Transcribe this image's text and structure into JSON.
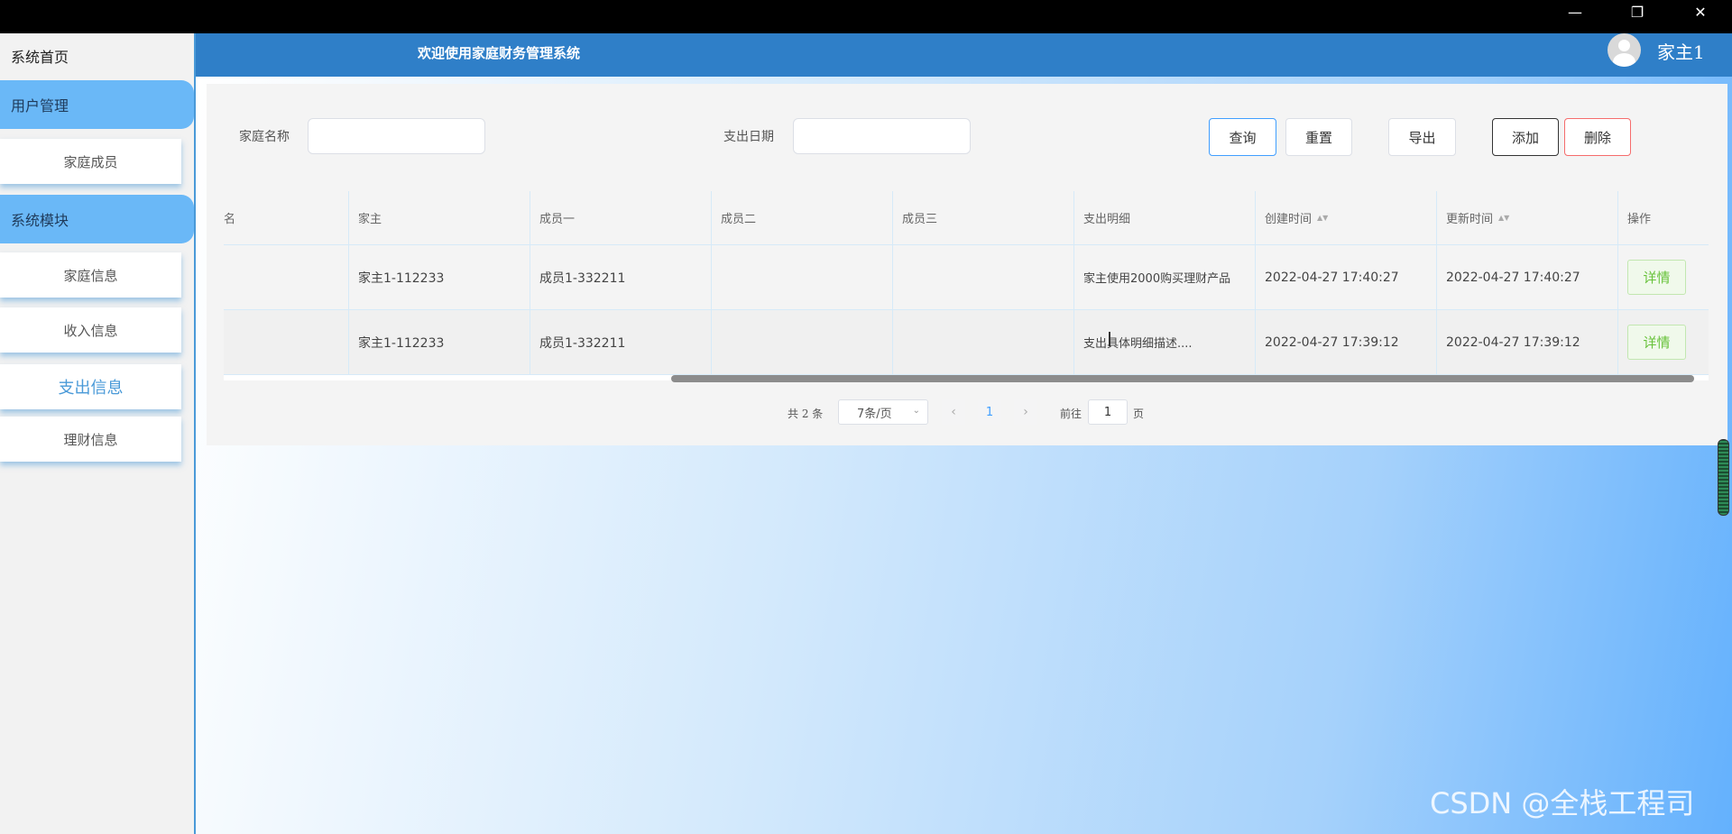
{
  "window": {
    "minimize_glyph": "—",
    "maximize_glyph": "❐",
    "close_glyph": "✕"
  },
  "sidebar": {
    "home": "系统首页",
    "groups": [
      {
        "label": "用户管理",
        "items": [
          {
            "label": "家庭成员",
            "active": false
          }
        ]
      },
      {
        "label": "系统模块",
        "items": [
          {
            "label": "家庭信息",
            "active": false
          },
          {
            "label": "收入信息",
            "active": false
          },
          {
            "label": "支出信息",
            "active": true
          },
          {
            "label": "理财信息",
            "active": false
          }
        ]
      }
    ]
  },
  "header": {
    "welcome": "欢迎使用家庭财务管理系统",
    "username": "家主1"
  },
  "filters": {
    "family_name_label": "家庭名称",
    "family_name_value": "",
    "expense_date_label": "支出日期",
    "expense_date_value": ""
  },
  "toolbar": {
    "query": "查询",
    "reset": "重置",
    "export": "导出",
    "add": "添加",
    "delete": "删除"
  },
  "table": {
    "columns": [
      "名",
      "家主",
      "成员一",
      "成员二",
      "成员三",
      "支出明细",
      "创建时间",
      "更新时间",
      "操作"
    ],
    "sort_glyph": "▲▼",
    "rows": [
      {
        "c0": "",
        "head": "家主1-112233",
        "member1": "成员1-332211",
        "member2": "",
        "member3": "",
        "detail": "家主使用2000购买理财产品",
        "created": "2022-04-27 17:40:27",
        "updated": "2022-04-27 17:40:27",
        "action": "详情"
      },
      {
        "c0": "",
        "head": "家主1-112233",
        "member1": "成员1-332211",
        "member2": "",
        "member3": "",
        "detail": "支出具体明细描述....",
        "created": "2022-04-27 17:39:12",
        "updated": "2022-04-27 17:39:12",
        "action": "详情"
      }
    ]
  },
  "pagination": {
    "total_text": "共 2 条",
    "page_size": "7条/页",
    "prev": "‹",
    "next": "›",
    "current_page": "1",
    "goto_label": "前往",
    "goto_value": "1",
    "page_suffix": "页"
  },
  "watermark": "CSDN @全栈工程司"
}
